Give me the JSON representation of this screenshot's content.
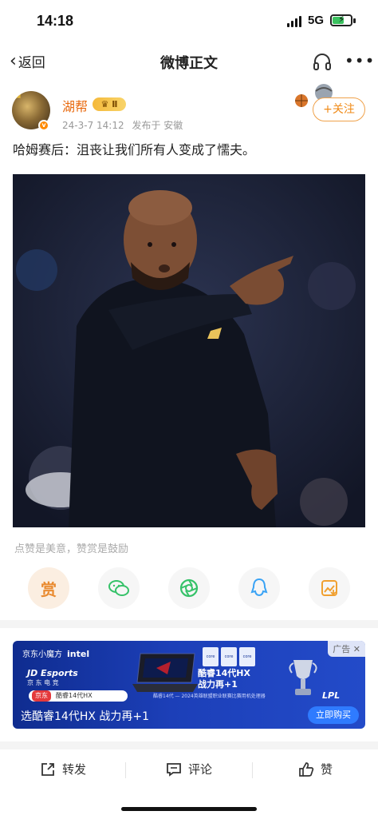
{
  "status": {
    "time": "14:18",
    "network": "5G"
  },
  "nav": {
    "back_label": "返回",
    "title": "微博正文"
  },
  "post": {
    "author": "湖帮",
    "vip_label": "Ⅱ",
    "date": "24-3-7 14:12",
    "published_from": "发布于 安徽",
    "follow_label": "+关注",
    "text": "哈姆赛后：沮丧让我们所有人变成了懦夫。"
  },
  "engagement": {
    "hint": "点赞是美意，赞赏是鼓励",
    "reward_label": "赏",
    "share_icons": [
      "wechat-icon",
      "moments-icon",
      "qq-icon",
      "save-image-icon"
    ]
  },
  "ad": {
    "tag": "广告",
    "brand": "京东小魔方",
    "brand2": "intel",
    "jd_title": "JD Esports",
    "jd_sub": "京 东 电 竞",
    "search_jd": "京东",
    "search_text": "酷睿14代HX",
    "hx_line1": "酷睿14代HX",
    "hx_line2": "战力再+1",
    "sub": "酷睿14代 — 2024英雄联盟职业联赛比赛用机处理器",
    "lpl": "LPL",
    "headline": "选酷睿14代HX 战力再+1",
    "cta": "立即购买"
  },
  "bottom": {
    "repost": "转发",
    "comment": "评论",
    "like": "赞"
  },
  "colors": {
    "accent": "#f08a17",
    "author": "#e8690e",
    "ad_bg": "#1c3fb8"
  }
}
